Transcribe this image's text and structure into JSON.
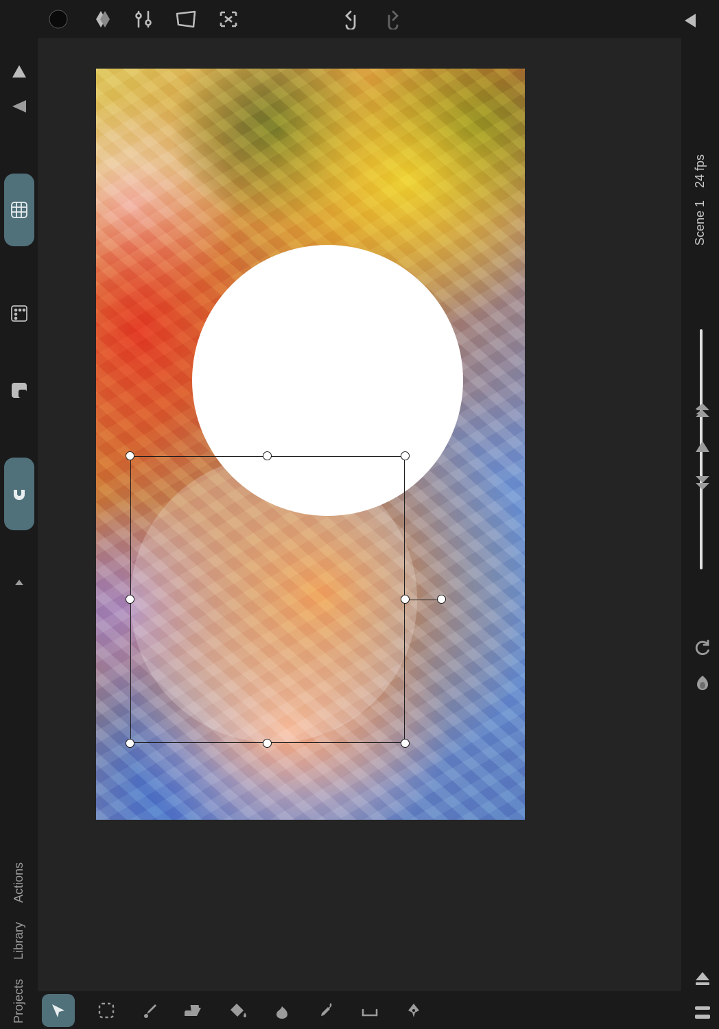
{
  "topbar": {
    "tools": [
      "color-picker",
      "gradient-diamond",
      "sliders",
      "perspective",
      "crop-select"
    ],
    "undo": "undo",
    "redo": "redo",
    "collapse_right": "collapse-right"
  },
  "leftbar": {
    "flip_v": "flip-vertical",
    "flip_h": "flip-horizontal",
    "grid_active": "grid",
    "grid_alt": "pixel-grid",
    "background": "background-fill",
    "snap_active": "snap-magnet",
    "expand": "expand-up"
  },
  "left_tabs": {
    "actions": "Actions",
    "library": "Library",
    "projects": "Projects"
  },
  "rightbar": {
    "fps": "24 fps",
    "scene": "Scene 1",
    "nav": [
      "skip-back",
      "prev-frame",
      "skip-forward"
    ],
    "extras": [
      "loop",
      "onion-skin"
    ],
    "bottom": [
      "eject",
      "timeline-toggle"
    ]
  },
  "bottombar": {
    "active": "move-transform",
    "tools": [
      "select-marquee",
      "brush",
      "eraser",
      "paint-bucket",
      "smudge",
      "eyedropper",
      "ruler",
      "pen"
    ]
  },
  "canvas": {
    "shapes": {
      "white_circle": "ellipse-1",
      "masked_circle": "ellipse-2-selected"
    },
    "selection": {
      "handles": 9
    }
  }
}
